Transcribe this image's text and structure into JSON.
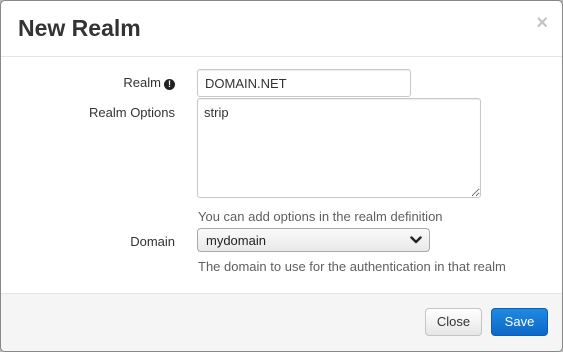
{
  "dialog": {
    "title": "New Realm",
    "close_icon": "×"
  },
  "form": {
    "realm": {
      "label": "Realm",
      "icon": "info-circle-icon",
      "icon_glyph": "!",
      "value": "DOMAIN.NET"
    },
    "realm_options": {
      "label": "Realm Options",
      "value": "strip",
      "help": "You can add options in the realm definition"
    },
    "domain": {
      "label": "Domain",
      "selected": "mydomain",
      "help": "The domain to use for the authentication in that realm"
    }
  },
  "footer": {
    "close_label": "Close",
    "save_label": "Save"
  },
  "colors": {
    "primary": "#0d68c8",
    "help_text": "#5f5f5f"
  }
}
